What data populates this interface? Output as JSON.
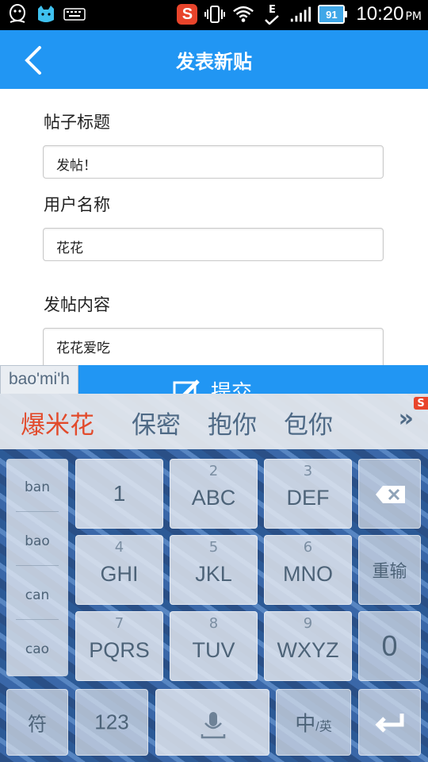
{
  "statusbar": {
    "time": "10:20",
    "ampm": "PM",
    "battery": "91",
    "network_letter": "E",
    "icons": [
      "qq-icon",
      "cat-icon",
      "keyboard-icon",
      "sogou-icon",
      "vibrate-icon",
      "wifi-icon",
      "signal-icon",
      "battery-icon"
    ]
  },
  "header": {
    "title": "发表新贴",
    "back_icon": "chevron-left-icon",
    "color": "#2196f3"
  },
  "form": {
    "title_label": "帖子标题",
    "title_value": "发帖！",
    "username_label": "用户名称",
    "username_value": "花花",
    "content_label": "发帖内容",
    "content_value": "花花爱吃",
    "submit_label": "提交",
    "submit_icon": "edit-icon"
  },
  "ime": {
    "composing": "bao'mi'h",
    "candidates": [
      "爆米花",
      "保密",
      "抱你",
      "包你"
    ],
    "more_icon": "double-chevron-right-icon",
    "pinyin_options": [
      "ban",
      "bao",
      "can",
      "cao"
    ],
    "keys": {
      "k1": {
        "num": "",
        "label": "1"
      },
      "k2": {
        "num": "2",
        "label": "ABC"
      },
      "k3": {
        "num": "3",
        "label": "DEF"
      },
      "k4": {
        "num": "4",
        "label": "GHI"
      },
      "k5": {
        "num": "5",
        "label": "JKL"
      },
      "k6": {
        "num": "6",
        "label": "MNO"
      },
      "k7": {
        "num": "7",
        "label": "PQRS"
      },
      "k8": {
        "num": "8",
        "label": "TUV"
      },
      "k9": {
        "num": "9",
        "label": "WXYZ"
      }
    },
    "reinput_label": "重输",
    "zero_label": "0",
    "symbol_label": "符",
    "num_label": "123",
    "lang_main": "中",
    "lang_alt": "/英",
    "accent_red": "#e24a2b"
  }
}
